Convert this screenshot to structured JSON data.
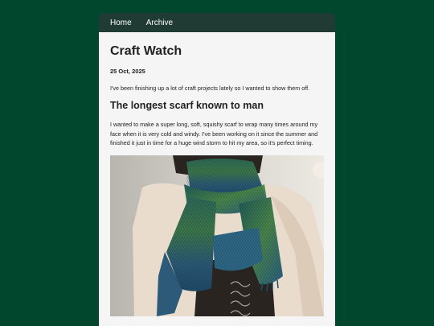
{
  "nav": {
    "home_label": "Home",
    "archive_label": "Archive"
  },
  "site": {
    "title": "Craft Watch"
  },
  "post": {
    "date": "25 Oct, 2025",
    "intro": "I've been finishing up a lot of craft projects lately so I wanted to show them off.",
    "title": "The longest scarf known to man",
    "body": "I wanted to make a super long, soft, squishy scarf to wrap many times around my face when it is very cold and windy. I've been working on it since the summer and finished it just in time for a huge wind storm to hit my area, so it's perfect timing."
  },
  "colors": {
    "background": "#00472e",
    "navbar": "#1f3b33",
    "content": "#f5f5f5"
  }
}
